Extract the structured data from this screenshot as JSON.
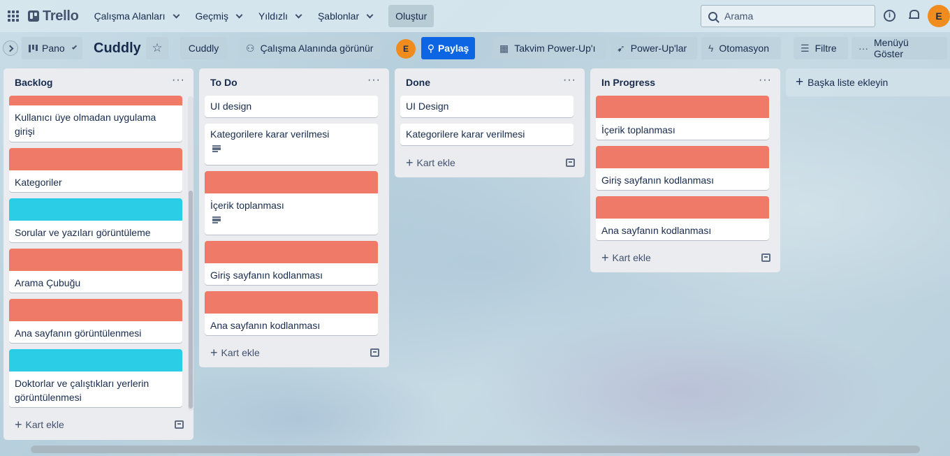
{
  "colors": {
    "red_label": "#f07a68",
    "cyan_label": "#2bcde6",
    "share_blue": "#0c66e4",
    "avatar_orange": "#f08c1e"
  },
  "topbar": {
    "logo": "Trello",
    "nav": [
      "Çalışma Alanları",
      "Geçmiş",
      "Yıldızlı",
      "Şablonlar"
    ],
    "create": "Oluştur",
    "search_placeholder": "Arama",
    "avatar": "E"
  },
  "board": {
    "view": "Pano",
    "title": "Cuddly",
    "workspace": "Cuddly",
    "visibility": "Çalışma Alanında görünür",
    "member_avatar": "E",
    "share": "Paylaş",
    "calendar": "Takvim Power-Up'ı",
    "powerups": "Power-Up'lar",
    "automation": "Otomasyon",
    "filter": "Filtre",
    "menu": "Menüyü Göster",
    "add_list": "Başka liste ekleyin",
    "add_card": "Kart ekle"
  },
  "lists": [
    {
      "title": "Backlog",
      "cards": [
        {
          "text": "Kullanıcı üye olmadan uygulama girişi",
          "cover": "red"
        },
        {
          "text": "Kategoriler",
          "cover": "red"
        },
        {
          "text": "Sorular ve yazıları görüntüleme",
          "cover": "cyan"
        },
        {
          "text": "Arama Çubuğu",
          "cover": "red"
        },
        {
          "text": "Ana sayfanın görüntülenmesi",
          "cover": "red"
        },
        {
          "text": "Doktorlar ve çalıştıkları yerlerin görüntülenmesi",
          "cover": "cyan"
        }
      ]
    },
    {
      "title": "To Do",
      "cards": [
        {
          "text": "UI design",
          "cover": ""
        },
        {
          "text": "Kategorilere karar verilmesi",
          "cover": "",
          "description": true
        },
        {
          "text": "İçerik toplanması",
          "cover": "red",
          "description": true
        },
        {
          "text": "Giriş sayfanın kodlanması",
          "cover": "red"
        },
        {
          "text": "Ana sayfanın kodlanması",
          "cover": "red"
        }
      ]
    },
    {
      "title": "Done",
      "cards": [
        {
          "text": "UI Design",
          "cover": ""
        },
        {
          "text": "Kategorilere karar verilmesi",
          "cover": ""
        }
      ]
    },
    {
      "title": "In Progress",
      "cards": [
        {
          "text": "İçerik toplanması",
          "cover": "red"
        },
        {
          "text": "Giriş sayfanın kodlanması",
          "cover": "red"
        },
        {
          "text": "Ana sayfanın kodlanması",
          "cover": "red"
        }
      ]
    }
  ]
}
